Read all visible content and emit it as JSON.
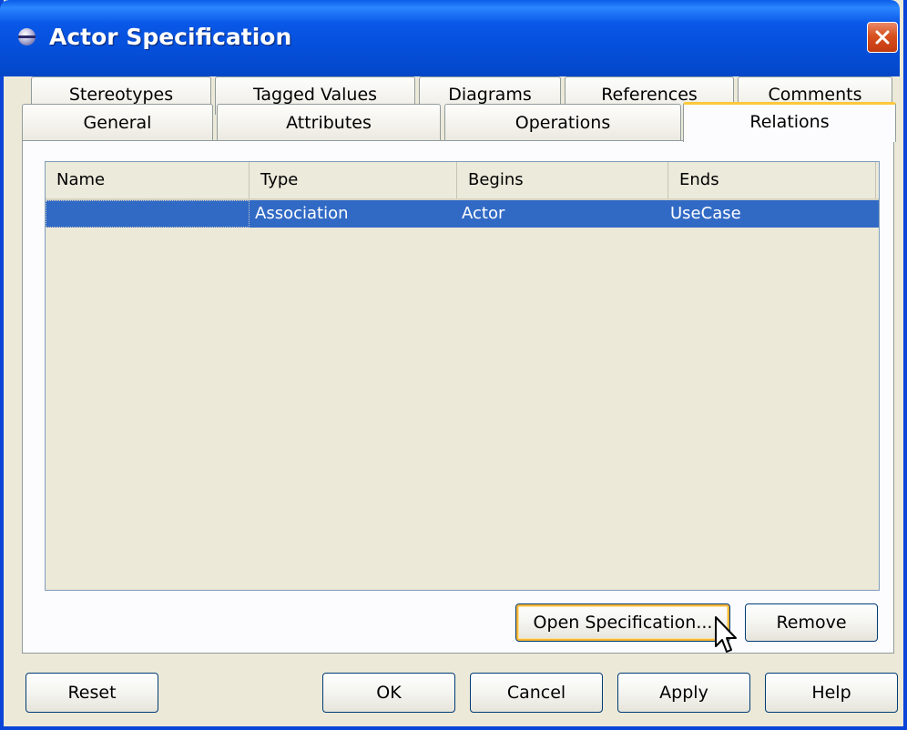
{
  "window": {
    "title": "Actor Specification",
    "icons": {
      "app": "circle-app-icon",
      "close": "close-icon"
    }
  },
  "tabs": {
    "row1": [
      "Stereotypes",
      "Tagged Values",
      "Diagrams",
      "References",
      "Comments"
    ],
    "row2": [
      "General",
      "Attributes",
      "Operations",
      "Relations"
    ],
    "selected": "Relations"
  },
  "relations_table": {
    "columns": [
      "Name",
      "Type",
      "Begins",
      "Ends"
    ],
    "rows": [
      {
        "name": "",
        "type": "Association",
        "begins": "Actor",
        "ends": "UseCase",
        "selected": true
      }
    ]
  },
  "panel_buttons": {
    "open_spec": "Open Specification...",
    "remove": "Remove"
  },
  "dialog_buttons": {
    "reset": "Reset",
    "ok": "OK",
    "cancel": "Cancel",
    "apply": "Apply",
    "help": "Help"
  },
  "colors": {
    "titlebar": "#0a58e8",
    "selection": "#316ac5",
    "tab_highlight": "#ffc83c",
    "dialog_bg": "#ece9d8"
  }
}
